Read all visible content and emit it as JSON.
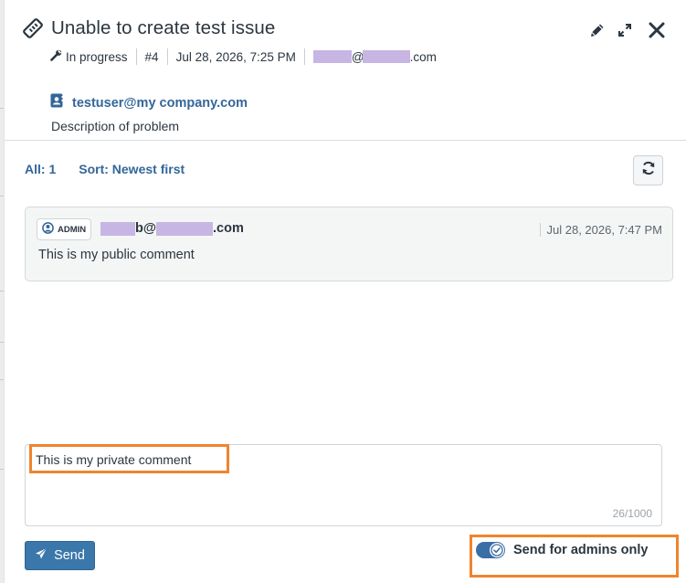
{
  "issue": {
    "title": "Unable to create test issue",
    "status": "In progress",
    "number": "#4",
    "created": "Jul 28, 2026, 7:25 PM",
    "reporter_email_domain": ".com",
    "reporter_email_at": "@",
    "contact": "testuser@my company.com",
    "description": "Description of problem"
  },
  "toolbar": {
    "count_label": "All: 1",
    "sort_label": "Sort: Newest first"
  },
  "comments": [
    {
      "badge": "ADMIN",
      "author_prefix": "b@",
      "author_suffix": ".com",
      "date": "Jul 28, 2026, 7:47 PM",
      "text": "This is my public comment"
    }
  ],
  "compose": {
    "value": "This is my private comment",
    "counter": "26/1000"
  },
  "actions": {
    "send_label": "Send",
    "admins_only_label": "Send for admins only",
    "admins_only_enabled": true
  },
  "colors": {
    "accent": "#336699",
    "button": "#3b77aa",
    "highlight": "#f0842d",
    "redaction": "#c7b6e3"
  },
  "icons": {
    "title": "tag-icon",
    "status": "wrench-icon",
    "contact": "contact-card-icon",
    "edit": "pencil-icon",
    "expand": "expand-icon",
    "close": "close-icon",
    "refresh": "refresh-icon",
    "badge": "user-circle-icon",
    "send": "paper-plane-icon",
    "toggle": "check-icon"
  }
}
